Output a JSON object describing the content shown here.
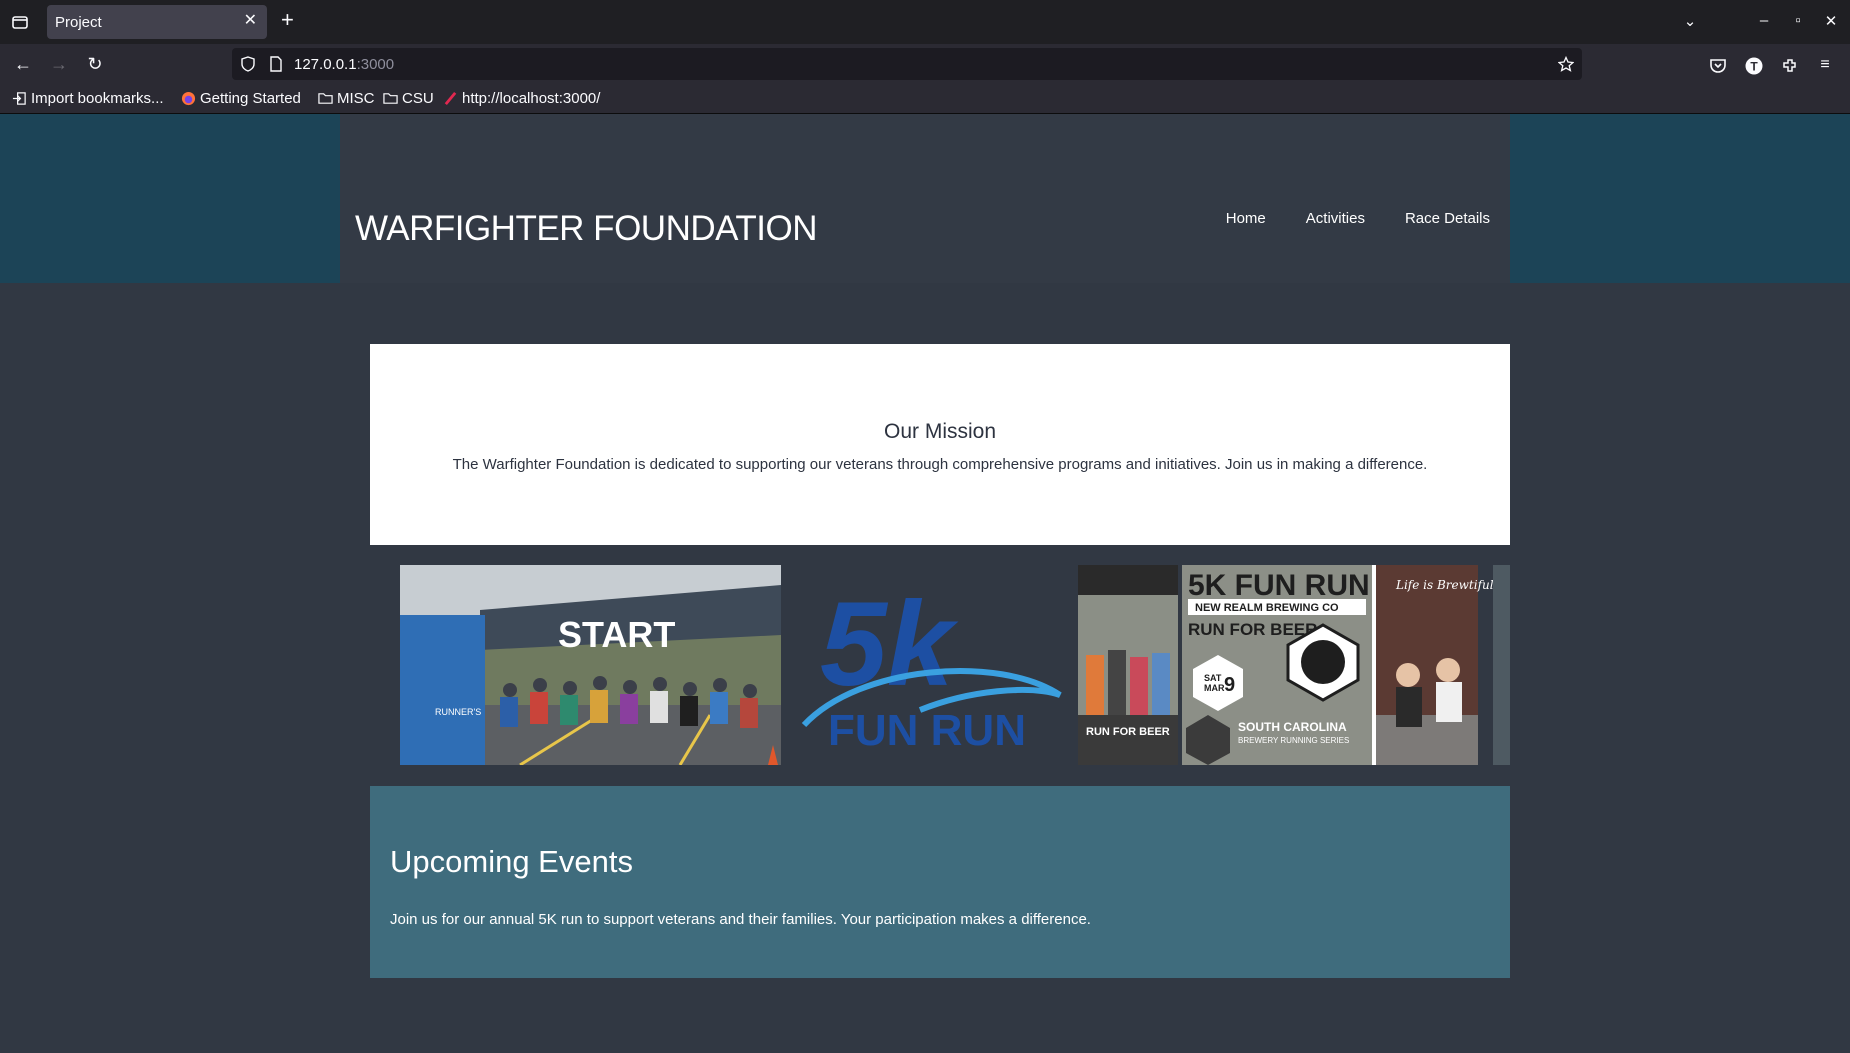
{
  "browser": {
    "tab_title": "Project",
    "url_host": "127.0.0.1",
    "url_port": ":3000",
    "bookmarks": [
      {
        "label": "Import bookmarks...",
        "icon": "import-icon"
      },
      {
        "label": "Getting Started",
        "icon": "firefox-icon"
      },
      {
        "label": "MISC",
        "icon": "folder-icon"
      },
      {
        "label": "CSU",
        "icon": "folder-icon"
      },
      {
        "label": "http://localhost:3000/",
        "icon": "link-icon"
      }
    ]
  },
  "site": {
    "title": "WARFIGHTER FOUNDATION",
    "nav": [
      "Home",
      "Activities",
      "Race Details"
    ],
    "mission": {
      "heading": "Our Mission",
      "body": "The Warfighter Foundation is dedicated to supporting our veterans through comprehensive programs and initiatives. Join us in making a difference."
    },
    "gallery": {
      "start_banner": "START",
      "start_side": "RUNNER'S",
      "fun_run_big": "5k",
      "fun_run_small": "FUN RUN",
      "poster_title": "5K FUN RUN",
      "poster_brewery": "NEW REALM BREWING CO",
      "poster_sub": "RUN FOR BEER",
      "poster_date_day": "SAT",
      "poster_date_month": "MAR",
      "poster_date_num": "9",
      "poster_series": "SOUTH CAROLINA",
      "poster_series2": "BREWERY RUNNING SERIES",
      "poster_tag": "Life is Brewtiful",
      "poster_side": "RUN FOR BEER"
    },
    "events": {
      "heading": "Upcoming Events",
      "body": "Join us for our annual 5K run to support veterans and their families. Your participation makes a difference."
    }
  },
  "colors": {
    "header_band": "#1c4457",
    "header_box": "#333a45",
    "page_bg": "#313843",
    "events_bg": "#3f6c7d"
  }
}
